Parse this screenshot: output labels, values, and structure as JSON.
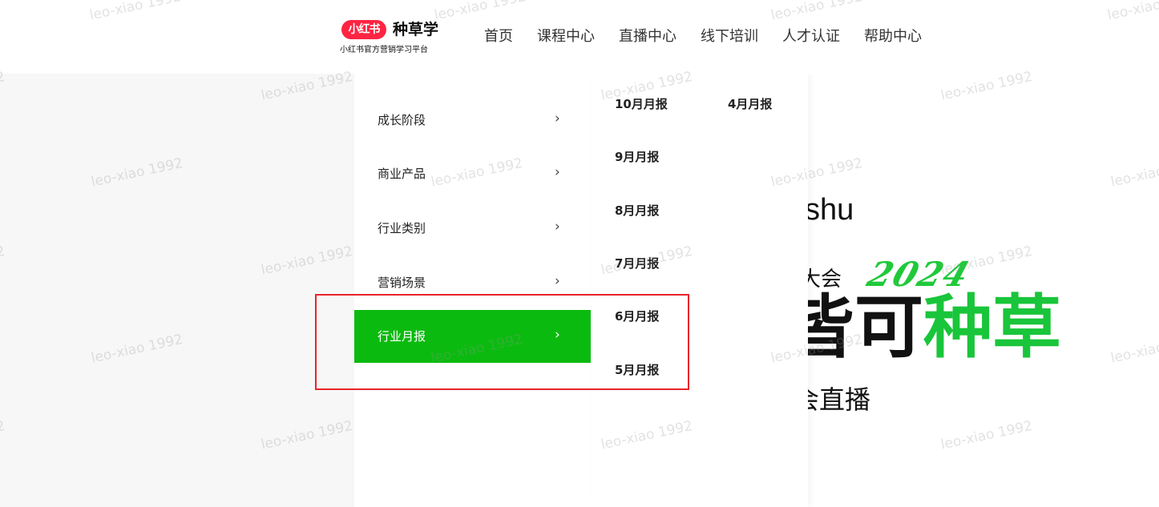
{
  "header": {
    "logo_badge": "小红书",
    "logo_name": "种草学",
    "logo_subtitle": "小红书官方营销学习平台",
    "nav": [
      "首页",
      "课程中心",
      "直播中心",
      "线下培训",
      "人才认证",
      "帮助中心"
    ]
  },
  "dropdown": {
    "categories": [
      {
        "label": "成长阶段",
        "chevron": "›"
      },
      {
        "label": "商业产品",
        "chevron": "›"
      },
      {
        "label": "行业类别",
        "chevron": "›"
      },
      {
        "label": "营销场景",
        "chevron": "›"
      },
      {
        "label": "行业月报",
        "chevron": "›",
        "active": true
      }
    ],
    "reports": [
      "10月月报",
      "4月月报",
      "9月月报",
      "8月月报",
      "7月月报",
      "6月月报",
      "5月月报"
    ]
  },
  "banner": {
    "brand": "shu",
    "event": "大会",
    "year": "2024",
    "slogan_dark": "皆可",
    "slogan_green": "种草",
    "live": "会直播"
  },
  "watermark": "leo-xiao 1992",
  "colors": {
    "accent_green": "#0bba0f",
    "brand_red": "#ff2442",
    "highlight_red": "#e8242b"
  }
}
